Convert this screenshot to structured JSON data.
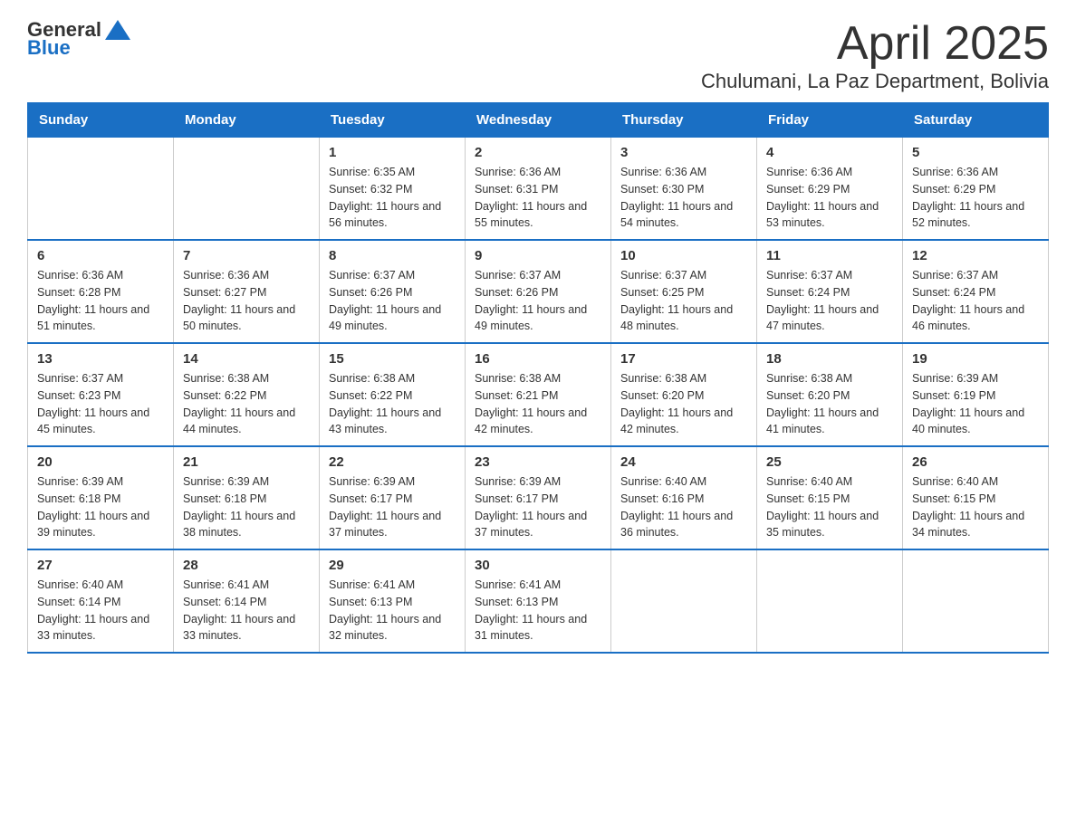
{
  "header": {
    "logo_general": "General",
    "logo_blue": "Blue",
    "title": "April 2025",
    "subtitle": "Chulumani, La Paz Department, Bolivia"
  },
  "calendar": {
    "days_of_week": [
      "Sunday",
      "Monday",
      "Tuesday",
      "Wednesday",
      "Thursday",
      "Friday",
      "Saturday"
    ],
    "weeks": [
      [
        {
          "day": "",
          "sunrise": "",
          "sunset": "",
          "daylight": ""
        },
        {
          "day": "",
          "sunrise": "",
          "sunset": "",
          "daylight": ""
        },
        {
          "day": "1",
          "sunrise": "Sunrise: 6:35 AM",
          "sunset": "Sunset: 6:32 PM",
          "daylight": "Daylight: 11 hours and 56 minutes."
        },
        {
          "day": "2",
          "sunrise": "Sunrise: 6:36 AM",
          "sunset": "Sunset: 6:31 PM",
          "daylight": "Daylight: 11 hours and 55 minutes."
        },
        {
          "day": "3",
          "sunrise": "Sunrise: 6:36 AM",
          "sunset": "Sunset: 6:30 PM",
          "daylight": "Daylight: 11 hours and 54 minutes."
        },
        {
          "day": "4",
          "sunrise": "Sunrise: 6:36 AM",
          "sunset": "Sunset: 6:29 PM",
          "daylight": "Daylight: 11 hours and 53 minutes."
        },
        {
          "day": "5",
          "sunrise": "Sunrise: 6:36 AM",
          "sunset": "Sunset: 6:29 PM",
          "daylight": "Daylight: 11 hours and 52 minutes."
        }
      ],
      [
        {
          "day": "6",
          "sunrise": "Sunrise: 6:36 AM",
          "sunset": "Sunset: 6:28 PM",
          "daylight": "Daylight: 11 hours and 51 minutes."
        },
        {
          "day": "7",
          "sunrise": "Sunrise: 6:36 AM",
          "sunset": "Sunset: 6:27 PM",
          "daylight": "Daylight: 11 hours and 50 minutes."
        },
        {
          "day": "8",
          "sunrise": "Sunrise: 6:37 AM",
          "sunset": "Sunset: 6:26 PM",
          "daylight": "Daylight: 11 hours and 49 minutes."
        },
        {
          "day": "9",
          "sunrise": "Sunrise: 6:37 AM",
          "sunset": "Sunset: 6:26 PM",
          "daylight": "Daylight: 11 hours and 49 minutes."
        },
        {
          "day": "10",
          "sunrise": "Sunrise: 6:37 AM",
          "sunset": "Sunset: 6:25 PM",
          "daylight": "Daylight: 11 hours and 48 minutes."
        },
        {
          "day": "11",
          "sunrise": "Sunrise: 6:37 AM",
          "sunset": "Sunset: 6:24 PM",
          "daylight": "Daylight: 11 hours and 47 minutes."
        },
        {
          "day": "12",
          "sunrise": "Sunrise: 6:37 AM",
          "sunset": "Sunset: 6:24 PM",
          "daylight": "Daylight: 11 hours and 46 minutes."
        }
      ],
      [
        {
          "day": "13",
          "sunrise": "Sunrise: 6:37 AM",
          "sunset": "Sunset: 6:23 PM",
          "daylight": "Daylight: 11 hours and 45 minutes."
        },
        {
          "day": "14",
          "sunrise": "Sunrise: 6:38 AM",
          "sunset": "Sunset: 6:22 PM",
          "daylight": "Daylight: 11 hours and 44 minutes."
        },
        {
          "day": "15",
          "sunrise": "Sunrise: 6:38 AM",
          "sunset": "Sunset: 6:22 PM",
          "daylight": "Daylight: 11 hours and 43 minutes."
        },
        {
          "day": "16",
          "sunrise": "Sunrise: 6:38 AM",
          "sunset": "Sunset: 6:21 PM",
          "daylight": "Daylight: 11 hours and 42 minutes."
        },
        {
          "day": "17",
          "sunrise": "Sunrise: 6:38 AM",
          "sunset": "Sunset: 6:20 PM",
          "daylight": "Daylight: 11 hours and 42 minutes."
        },
        {
          "day": "18",
          "sunrise": "Sunrise: 6:38 AM",
          "sunset": "Sunset: 6:20 PM",
          "daylight": "Daylight: 11 hours and 41 minutes."
        },
        {
          "day": "19",
          "sunrise": "Sunrise: 6:39 AM",
          "sunset": "Sunset: 6:19 PM",
          "daylight": "Daylight: 11 hours and 40 minutes."
        }
      ],
      [
        {
          "day": "20",
          "sunrise": "Sunrise: 6:39 AM",
          "sunset": "Sunset: 6:18 PM",
          "daylight": "Daylight: 11 hours and 39 minutes."
        },
        {
          "day": "21",
          "sunrise": "Sunrise: 6:39 AM",
          "sunset": "Sunset: 6:18 PM",
          "daylight": "Daylight: 11 hours and 38 minutes."
        },
        {
          "day": "22",
          "sunrise": "Sunrise: 6:39 AM",
          "sunset": "Sunset: 6:17 PM",
          "daylight": "Daylight: 11 hours and 37 minutes."
        },
        {
          "day": "23",
          "sunrise": "Sunrise: 6:39 AM",
          "sunset": "Sunset: 6:17 PM",
          "daylight": "Daylight: 11 hours and 37 minutes."
        },
        {
          "day": "24",
          "sunrise": "Sunrise: 6:40 AM",
          "sunset": "Sunset: 6:16 PM",
          "daylight": "Daylight: 11 hours and 36 minutes."
        },
        {
          "day": "25",
          "sunrise": "Sunrise: 6:40 AM",
          "sunset": "Sunset: 6:15 PM",
          "daylight": "Daylight: 11 hours and 35 minutes."
        },
        {
          "day": "26",
          "sunrise": "Sunrise: 6:40 AM",
          "sunset": "Sunset: 6:15 PM",
          "daylight": "Daylight: 11 hours and 34 minutes."
        }
      ],
      [
        {
          "day": "27",
          "sunrise": "Sunrise: 6:40 AM",
          "sunset": "Sunset: 6:14 PM",
          "daylight": "Daylight: 11 hours and 33 minutes."
        },
        {
          "day": "28",
          "sunrise": "Sunrise: 6:41 AM",
          "sunset": "Sunset: 6:14 PM",
          "daylight": "Daylight: 11 hours and 33 minutes."
        },
        {
          "day": "29",
          "sunrise": "Sunrise: 6:41 AM",
          "sunset": "Sunset: 6:13 PM",
          "daylight": "Daylight: 11 hours and 32 minutes."
        },
        {
          "day": "30",
          "sunrise": "Sunrise: 6:41 AM",
          "sunset": "Sunset: 6:13 PM",
          "daylight": "Daylight: 11 hours and 31 minutes."
        },
        {
          "day": "",
          "sunrise": "",
          "sunset": "",
          "daylight": ""
        },
        {
          "day": "",
          "sunrise": "",
          "sunset": "",
          "daylight": ""
        },
        {
          "day": "",
          "sunrise": "",
          "sunset": "",
          "daylight": ""
        }
      ]
    ]
  }
}
